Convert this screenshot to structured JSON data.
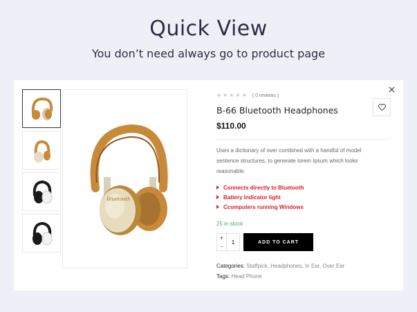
{
  "page": {
    "heading": "Quick View",
    "subheading": "You don’t need always go to product page"
  },
  "modal": {
    "close_icon": "close-icon",
    "thumbnails": [
      {
        "name": "headphones-gold-side"
      },
      {
        "name": "headphones-gold-front"
      },
      {
        "name": "headphones-black-side"
      },
      {
        "name": "headphones-black-front"
      }
    ],
    "product": {
      "reviews": "( 0 reviews )",
      "rating": 0,
      "title": "B-66 Bluetooth Headphones",
      "price": "$110.00",
      "description": "Uses a dictionary of over combined with a handful of model sentence structures, to generate lorem Ipsum which looks reasonable.",
      "features": [
        "Connects directly to Bluetooth",
        "Battery Indicator light",
        "Ccomputers running Windows"
      ],
      "stock": "25 in stock",
      "quantity": "1",
      "add_to_cart": "ADD TO CART",
      "categories_label": "Categories:",
      "categories_value": "Staffpick, Headphones, In Ear, Over Ear",
      "tags_label": "Tags:",
      "tags_value": "Head Phone"
    },
    "colors": {
      "accent_red": "#d4202c",
      "stock_green": "#4caf50",
      "button_black": "#000000"
    }
  }
}
